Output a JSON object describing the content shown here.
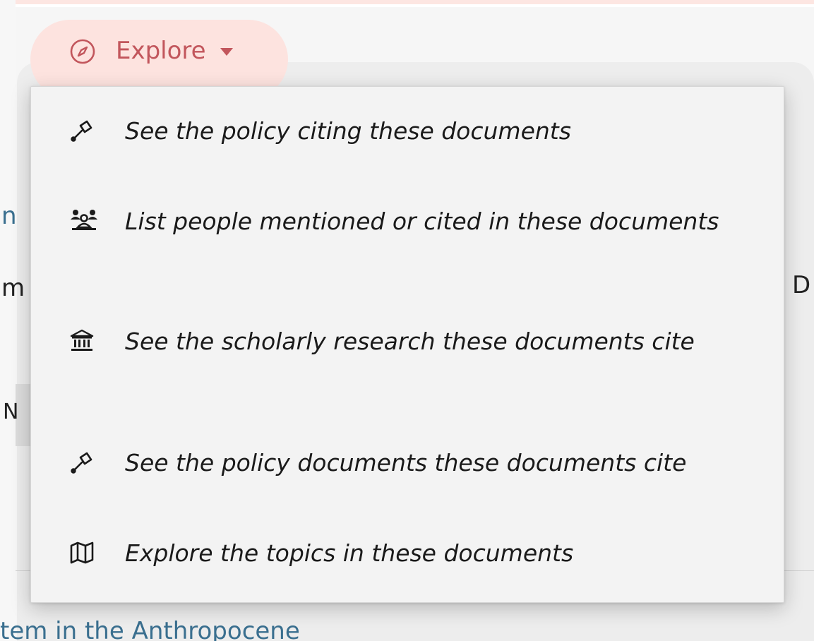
{
  "toolbar": {
    "explore_label": "Explore"
  },
  "explore_menu": {
    "items": [
      {
        "icon": "gavel-icon",
        "label": "See the policy citing these documents"
      },
      {
        "icon": "people-icon",
        "label": "List people mentioned or cited in these documents"
      },
      {
        "icon": "institution-icon",
        "label": "See the scholarly research these documents cite"
      },
      {
        "icon": "gavel-icon",
        "label": "See the policy documents these documents cite"
      },
      {
        "icon": "map-icon",
        "label": "Explore the topics in these documents"
      }
    ]
  },
  "background": {
    "fragment_link_1": "n",
    "fragment_text_1": "m",
    "fragment_text_right": "D",
    "fragment_text_2": "N",
    "fragment_bottom_link": "tem in the Anthropocene"
  },
  "colors": {
    "accent": "#c2565c",
    "accent_bg": "#fde3df",
    "link": "#3a6f8f",
    "menu_bg": "#f3f3f3"
  }
}
